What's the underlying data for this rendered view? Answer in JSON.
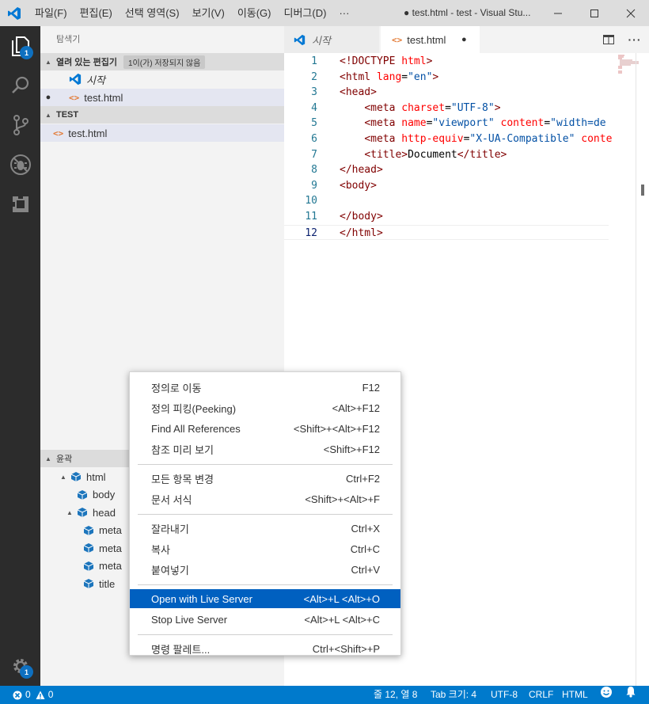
{
  "titlebar": {
    "menu": [
      "파일(F)",
      "편집(E)",
      "선택 영역(S)",
      "보기(V)",
      "이동(G)",
      "디버그(D)",
      "···"
    ],
    "window_title": "● test.html - test - Visual Stu..."
  },
  "activity": {
    "explorer_badge": "1",
    "settings_badge": "1"
  },
  "sidebar": {
    "title": "탐색기",
    "open_editors": {
      "label": "열려 있는 편집기",
      "badge": "1이(가) 저장되지 않음",
      "items": [
        {
          "icon": "vscode-logo-icon",
          "label": "시작"
        },
        {
          "icon": "html-code-icon",
          "label": "test.html",
          "dirty": "●"
        }
      ]
    },
    "workspace": {
      "label": "TEST",
      "items": [
        {
          "icon": "html-code-icon",
          "label": "test.html"
        }
      ]
    },
    "outline": {
      "label": "윤곽",
      "items": [
        {
          "label": "html",
          "indent": 1,
          "twisty": "▲"
        },
        {
          "label": "body",
          "indent": 2,
          "twisty": ""
        },
        {
          "label": "head",
          "indent": 2,
          "twisty": "▲"
        },
        {
          "label": "meta",
          "indent": 3,
          "twisty": ""
        },
        {
          "label": "meta",
          "indent": 3,
          "twisty": ""
        },
        {
          "label": "meta",
          "indent": 3,
          "twisty": ""
        },
        {
          "label": "title",
          "indent": 3,
          "twisty": ""
        }
      ]
    }
  },
  "editor": {
    "tabs": [
      {
        "label": "시작",
        "active": false
      },
      {
        "label": "test.html",
        "active": true,
        "dirty": "●"
      }
    ],
    "lines": [
      {
        "n": "1",
        "tokens": [
          [
            "t-tag",
            "<!DOCTYPE "
          ],
          [
            "t-attr",
            "html"
          ],
          [
            "t-tag",
            ">"
          ]
        ]
      },
      {
        "n": "2",
        "tokens": [
          [
            "t-tag",
            "<html "
          ],
          [
            "t-attr",
            "lang"
          ],
          [
            "t-txt",
            "="
          ],
          [
            "t-str",
            "\"en\""
          ],
          [
            "t-tag",
            ">"
          ]
        ]
      },
      {
        "n": "3",
        "tokens": [
          [
            "t-tag",
            "<head>"
          ]
        ]
      },
      {
        "n": "4",
        "tokens": [
          [
            "t-txt",
            "    "
          ],
          [
            "t-tag",
            "<meta "
          ],
          [
            "t-attr",
            "charset"
          ],
          [
            "t-txt",
            "="
          ],
          [
            "t-str",
            "\"UTF-8\""
          ],
          [
            "t-tag",
            ">"
          ]
        ]
      },
      {
        "n": "5",
        "tokens": [
          [
            "t-txt",
            "    "
          ],
          [
            "t-tag",
            "<meta "
          ],
          [
            "t-attr",
            "name"
          ],
          [
            "t-txt",
            "="
          ],
          [
            "t-str",
            "\"viewport\""
          ],
          [
            "t-txt",
            " "
          ],
          [
            "t-attr",
            "content"
          ],
          [
            "t-txt",
            "="
          ],
          [
            "t-str",
            "\"width=de"
          ]
        ]
      },
      {
        "n": "6",
        "tokens": [
          [
            "t-txt",
            "    "
          ],
          [
            "t-tag",
            "<meta "
          ],
          [
            "t-attr",
            "http-equiv"
          ],
          [
            "t-txt",
            "="
          ],
          [
            "t-str",
            "\"X-UA-Compatible\""
          ],
          [
            "t-txt",
            " "
          ],
          [
            "t-attr",
            "conte"
          ]
        ]
      },
      {
        "n": "7",
        "tokens": [
          [
            "t-txt",
            "    "
          ],
          [
            "t-tag",
            "<title>"
          ],
          [
            "t-txt",
            "Document"
          ],
          [
            "t-tag",
            "</title>"
          ]
        ]
      },
      {
        "n": "8",
        "tokens": [
          [
            "t-tag",
            "</head>"
          ]
        ]
      },
      {
        "n": "9",
        "tokens": [
          [
            "t-tag",
            "<body>"
          ]
        ]
      },
      {
        "n": "10",
        "tokens": []
      },
      {
        "n": "11",
        "tokens": [
          [
            "t-tag",
            "</body>"
          ]
        ]
      },
      {
        "n": "12",
        "tokens": [
          [
            "t-tag",
            "</html>"
          ]
        ]
      }
    ]
  },
  "context_menu": {
    "groups": [
      [
        {
          "label": "정의로 이동",
          "shortcut": "F12"
        },
        {
          "label": "정의 피킹(Peeking)",
          "shortcut": "<Alt>+F12"
        },
        {
          "label": "Find All References",
          "shortcut": "<Shift>+<Alt>+F12"
        },
        {
          "label": "참조 미리 보기",
          "shortcut": "<Shift>+F12"
        }
      ],
      [
        {
          "label": "모든 항목 변경",
          "shortcut": "Ctrl+F2"
        },
        {
          "label": "문서 서식",
          "shortcut": "<Shift>+<Alt>+F"
        }
      ],
      [
        {
          "label": "잘라내기",
          "shortcut": "Ctrl+X"
        },
        {
          "label": "복사",
          "shortcut": "Ctrl+C"
        },
        {
          "label": "붙여넣기",
          "shortcut": "Ctrl+V"
        }
      ],
      [
        {
          "label": "Open with Live Server",
          "shortcut": "<Alt>+L <Alt>+O",
          "highlighted": true
        },
        {
          "label": "Stop Live Server",
          "shortcut": "<Alt>+L <Alt>+C"
        }
      ],
      [
        {
          "label": "명령 팔레트...",
          "shortcut": "Ctrl+<Shift>+P"
        }
      ]
    ]
  },
  "statusbar": {
    "errors": "0",
    "warnings": "0",
    "position": "줄 12, 열 8",
    "tab_size": "Tab 크기: 4",
    "encoding": "UTF-8",
    "eol": "CRLF",
    "language": "HTML"
  },
  "colors": {
    "accent": "#007acc",
    "menu_highlight": "#0060c0",
    "badge": "#0e70c0"
  }
}
